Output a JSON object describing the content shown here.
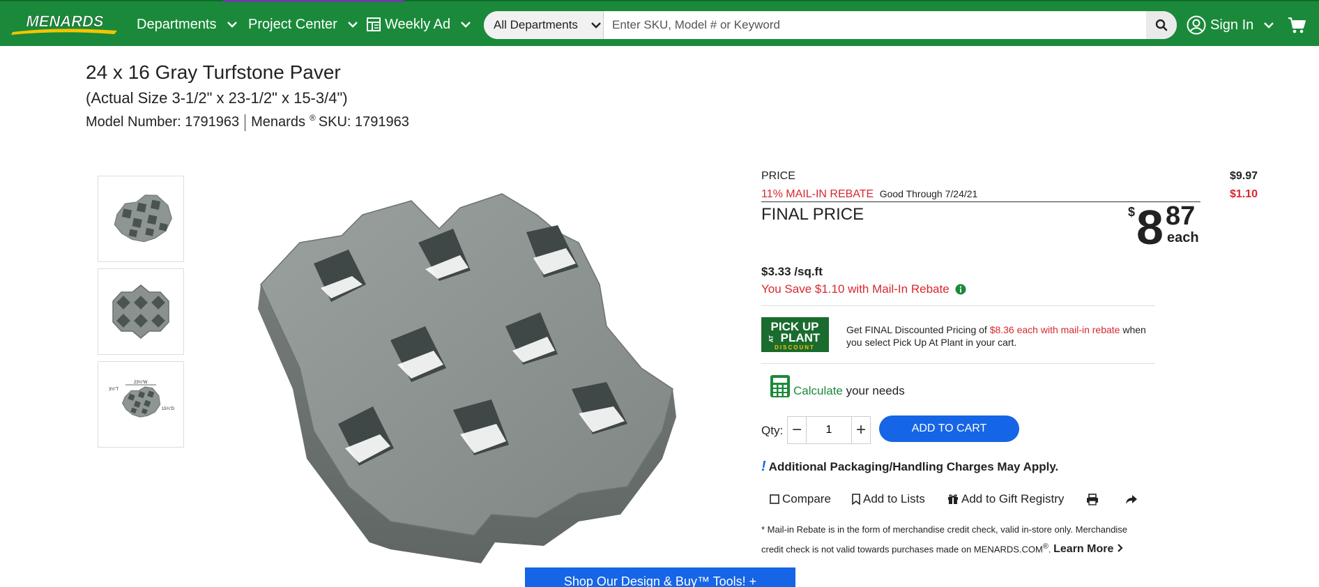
{
  "header": {
    "logo_text": "MENARDS",
    "nav": [
      {
        "label": "Departments"
      },
      {
        "label": "Project Center"
      },
      {
        "label": "Weekly Ad"
      }
    ],
    "search": {
      "department": "All Departments",
      "placeholder": "Enter SKU, Model # or Keyword",
      "value": ""
    },
    "signin_label": "Sign In",
    "colors": {
      "bar": "#1a8a3a",
      "accent": "#6b3fa0"
    }
  },
  "product": {
    "title": "24 x 16 Gray Turfstone Paver",
    "subtitle": "(Actual Size 3-1/2\" x 23-1/2\" x 15-3/4\")",
    "model_label": "Model Number: 1791963",
    "brand": "Menards",
    "registered": "®",
    "sku_label": "SKU: 1791963"
  },
  "thumbnails": [
    {
      "name": "thumb-1",
      "kind": "angled-view"
    },
    {
      "name": "thumb-2",
      "kind": "top-view"
    },
    {
      "name": "thumb-3",
      "kind": "dimension-diagram",
      "dim_height": "3½\"T",
      "dim_width": "23½\"W",
      "dim_depth": "15¾\"D"
    }
  ],
  "pricing": {
    "price_label": "PRICE",
    "price_value": "$9.97",
    "rebate_label": "11% MAIL-IN REBATE",
    "rebate_good": "Good Through 7/24/21",
    "rebate_value": "$1.10",
    "final_label": "FINAL PRICE",
    "final_dollar_sign": "$",
    "final_whole": "8",
    "final_cents": "87",
    "final_unit": "each",
    "per_sqft": "$3.33 /sq.ft",
    "you_save": "You Save $1.10 with Mail-In Rebate",
    "colors": {
      "rebate": "#d8272e",
      "text": "#222222"
    }
  },
  "pickup": {
    "badge_line1": "PICK UP",
    "badge_line2_a": "AT",
    "badge_line2_b": "PLANT",
    "badge_line3": "DISCOUNT",
    "text_before": "Get FINAL Discounted Pricing of ",
    "text_red": "$8.36 each with mail-in rebate",
    "text_after": " when you select Pick Up At Plant in your cart."
  },
  "calculator": {
    "link": "Calculate",
    "rest": " your needs"
  },
  "quantity": {
    "label": "Qty:",
    "value": "1",
    "minus": "−",
    "plus": "+"
  },
  "cart_button": "ADD TO CART",
  "handling_notice": "Additional Packaging/Handling Charges May Apply.",
  "actions": [
    {
      "label": "Compare"
    },
    {
      "label": "Add to Lists"
    },
    {
      "label": "Add to Gift Registry"
    }
  ],
  "footnote": {
    "text": "* Mail-in Rebate is in the form of merchandise credit check, valid in-store only. Merchandise credit check is not valid towards purchases made on MENARDS.COM",
    "reg": "®",
    "period": ".",
    "learn_more": "Learn More"
  },
  "promo_button": "Shop Our Design & Buy™ Tools!  +"
}
